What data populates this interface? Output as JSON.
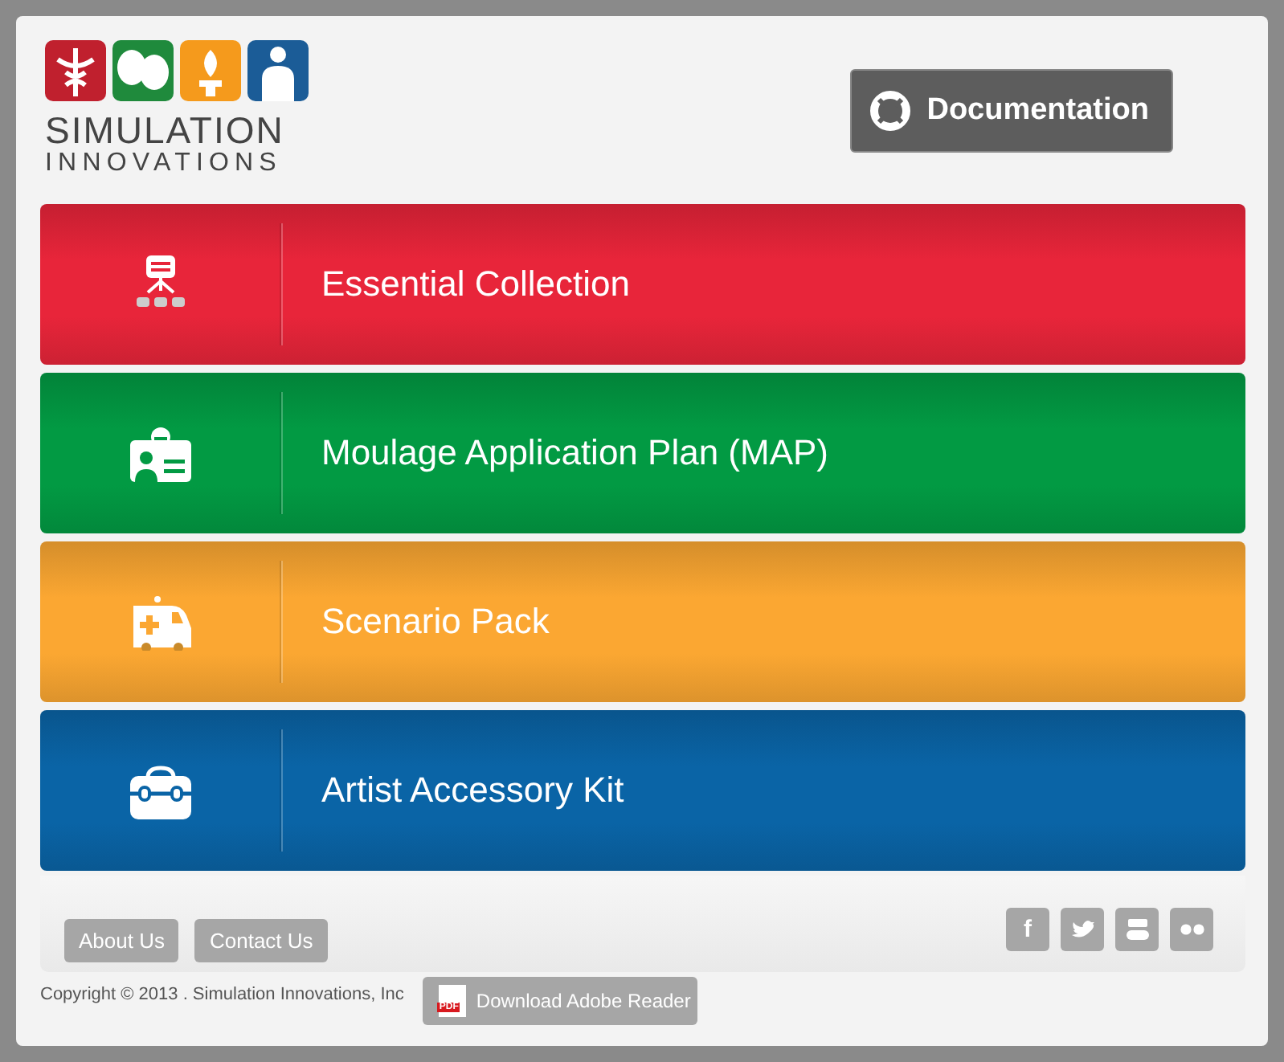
{
  "logo": {
    "line_1": "SIMULATION",
    "line_2": "INNOVATIONS"
  },
  "documentation_button": {
    "label": "Documentation"
  },
  "menu": [
    {
      "label": "Essential Collection",
      "kind": "presentation",
      "color": "#e8253a"
    },
    {
      "label": "Moulage Application Plan (MAP)",
      "kind": "badge",
      "color": "#029a43"
    },
    {
      "label": "Scenario Pack",
      "kind": "ambulance",
      "color": "#fba732"
    },
    {
      "label": "Artist Accessory Kit",
      "kind": "toolbox",
      "color": "#0a64a6"
    }
  ],
  "footer_links": [
    "About Us",
    "Contact Us"
  ],
  "social": [
    {
      "kind": "facebook",
      "label": "f"
    },
    {
      "kind": "twitter"
    },
    {
      "kind": "youtube"
    },
    {
      "kind": "flickr"
    }
  ],
  "copyright": "Copyright © 2013 . Simulation Innovations, Inc",
  "adobe_button": {
    "label": "Download Adobe Reader",
    "badge": "PDF"
  }
}
